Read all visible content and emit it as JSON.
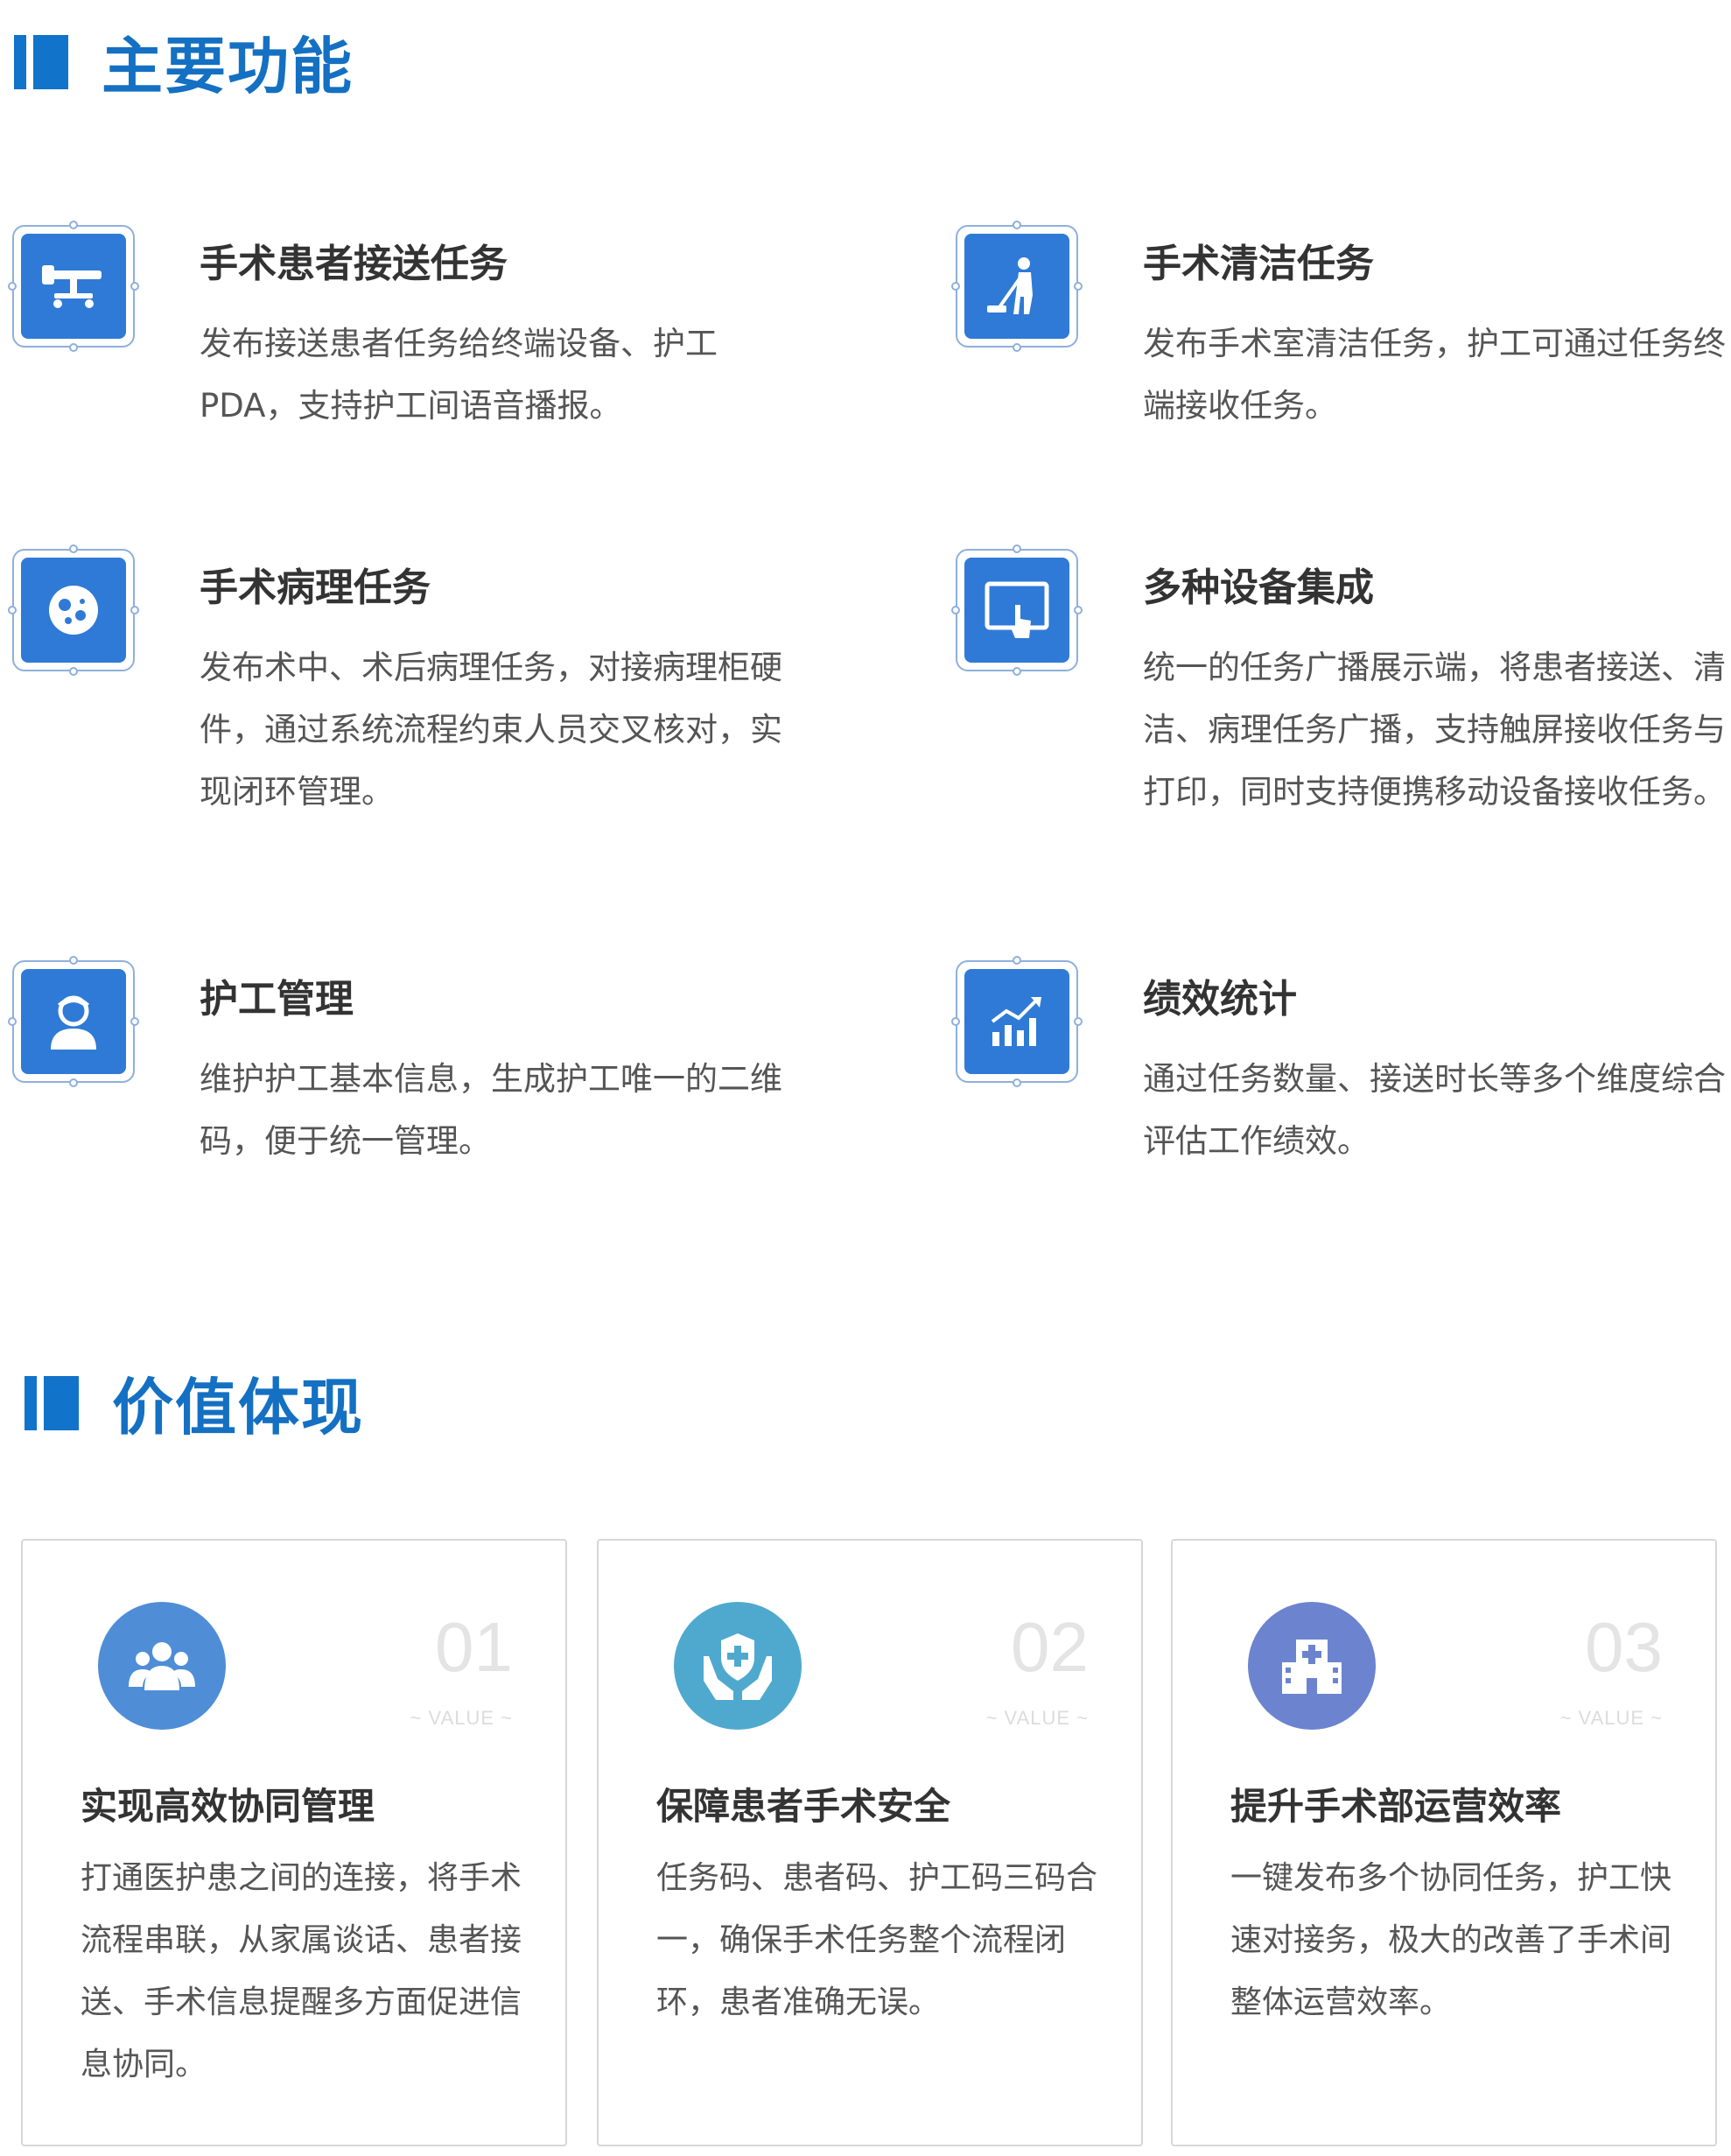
{
  "section1": {
    "title": "主要功能"
  },
  "features": [
    {
      "icon": "surgical-bed-icon",
      "title": "手术患者接送任务",
      "desc": "发布接送患者任务给终端设备、护工PDA，支持护工间语音播报。"
    },
    {
      "icon": "cleaning-mop-icon",
      "title": "手术清洁任务",
      "desc": "发布手术室清洁任务，护工可通过任务终端接收任务。"
    },
    {
      "icon": "pathology-cells-icon",
      "title": "手术病理任务",
      "desc": "发布术中、术后病理任务，对接病理柜硬件，通过系统流程约束人员交叉核对，实现闭环管理。"
    },
    {
      "icon": "touch-screen-icon",
      "title": "多种设备集成",
      "desc": "统一的任务广播展示端，将患者接送、清洁、病理任务广播，支持触屏接收任务与打印，同时支持便携移动设备接收任务。"
    },
    {
      "icon": "nurse-worker-icon",
      "title": "护工管理",
      "desc": "维护护工基本信息，生成护工唯一的二维码，便于统一管理。"
    },
    {
      "icon": "growth-chart-icon",
      "title": "绩效统计",
      "desc": "通过任务数量、接送时长等多个维度综合评估工作绩效。"
    }
  ],
  "section2": {
    "title": "价值体现"
  },
  "cards": [
    {
      "num": "01",
      "value_label": "~ VALUE ~",
      "icon": "team-group-icon",
      "color": "#4f8ed6",
      "title": "实现高效协同管理",
      "desc": "打通医护患之间的连接，将手术流程串联，从家属谈话、患者接送、手术信息提醒多方面促进信息协同。"
    },
    {
      "num": "02",
      "value_label": "~ VALUE ~",
      "icon": "shield-hands-icon",
      "color": "#4fa9cf",
      "title": "保障患者手术安全",
      "desc": "任务码、患者码、护工码三码合一，确保手术任务整个流程闭环，患者准确无误。"
    },
    {
      "num": "03",
      "value_label": "~ VALUE ~",
      "icon": "hospital-building-icon",
      "color": "#6c84cf",
      "title": "提升手术部运营效率",
      "desc": "一键发布多个协同任务，护工快速对接务，极大的改善了手术间整体运营效率。"
    }
  ]
}
